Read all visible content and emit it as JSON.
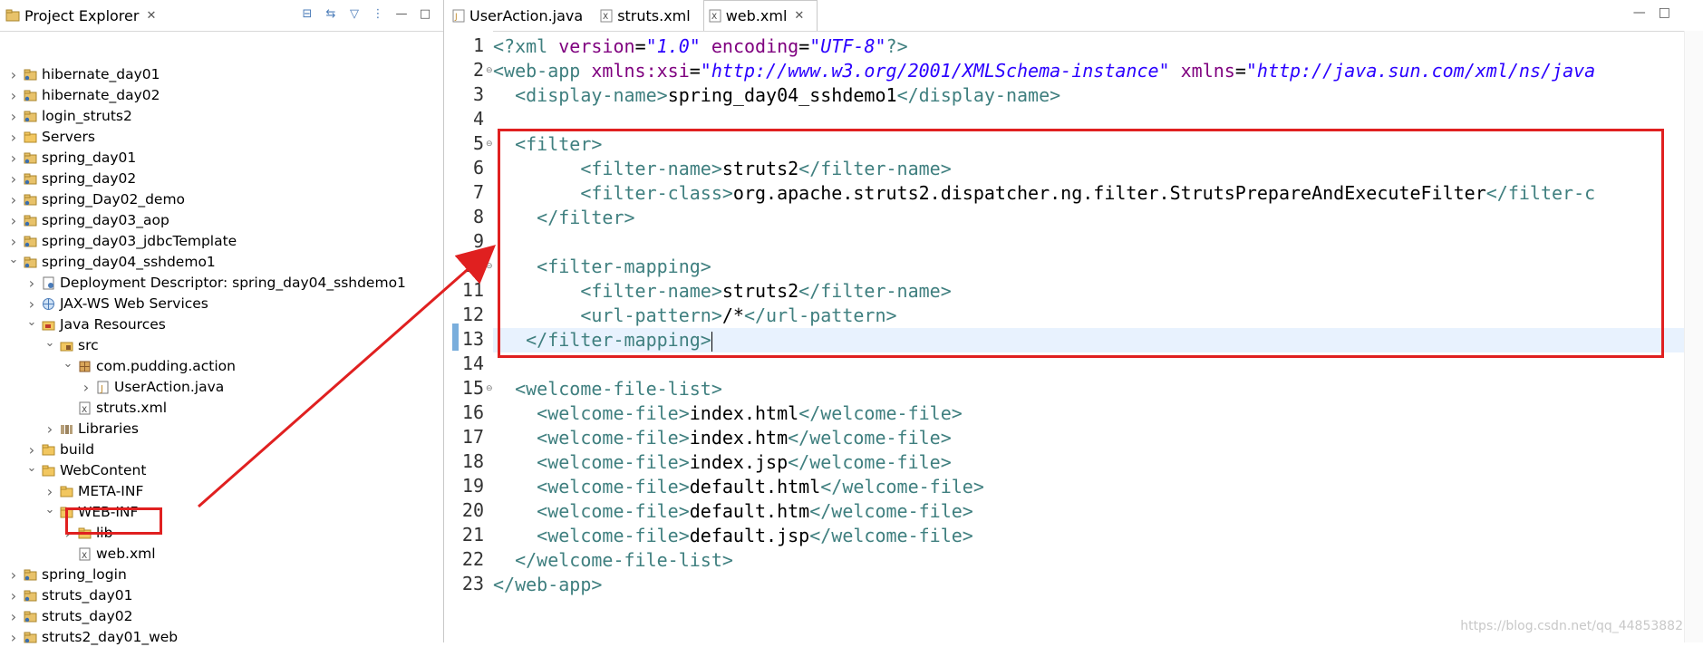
{
  "explorer": {
    "title": "Project Explorer",
    "items": [
      {
        "label": "hibernate_day01",
        "depth": 0,
        "expanded": false,
        "icon": "project-icon"
      },
      {
        "label": "hibernate_day02",
        "depth": 0,
        "expanded": false,
        "icon": "project-icon"
      },
      {
        "label": "login_struts2",
        "depth": 0,
        "expanded": false,
        "icon": "project-icon"
      },
      {
        "label": "Servers",
        "depth": 0,
        "expanded": false,
        "icon": "folder-icon"
      },
      {
        "label": "spring_day01",
        "depth": 0,
        "expanded": false,
        "icon": "project-icon"
      },
      {
        "label": "spring_day02",
        "depth": 0,
        "expanded": false,
        "icon": "project-icon"
      },
      {
        "label": "spring_Day02_demo",
        "depth": 0,
        "expanded": false,
        "icon": "project-icon"
      },
      {
        "label": "spring_day03_aop",
        "depth": 0,
        "expanded": false,
        "icon": "project-icon"
      },
      {
        "label": "spring_day03_jdbcTemplate",
        "depth": 0,
        "expanded": false,
        "icon": "project-icon"
      },
      {
        "label": "spring_day04_sshdemo1",
        "depth": 0,
        "expanded": true,
        "icon": "project-icon"
      },
      {
        "label": "Deployment Descriptor: spring_day04_sshdemo1",
        "depth": 1,
        "expanded": false,
        "icon": "descriptor-icon"
      },
      {
        "label": "JAX-WS Web Services",
        "depth": 1,
        "expanded": false,
        "icon": "webservice-icon"
      },
      {
        "label": "Java Resources",
        "depth": 1,
        "expanded": true,
        "icon": "java-resources-icon"
      },
      {
        "label": "src",
        "depth": 2,
        "expanded": true,
        "icon": "source-folder-icon"
      },
      {
        "label": "com.pudding.action",
        "depth": 3,
        "expanded": true,
        "icon": "package-icon"
      },
      {
        "label": "UserAction.java",
        "depth": 4,
        "expanded": false,
        "icon": "java-file-icon"
      },
      {
        "label": "struts.xml",
        "depth": 3,
        "expanded": null,
        "icon": "xml-file-icon"
      },
      {
        "label": "Libraries",
        "depth": 2,
        "expanded": false,
        "icon": "library-icon"
      },
      {
        "label": "build",
        "depth": 1,
        "expanded": false,
        "icon": "folder-icon"
      },
      {
        "label": "WebContent",
        "depth": 1,
        "expanded": true,
        "icon": "folder-icon"
      },
      {
        "label": "META-INF",
        "depth": 2,
        "expanded": false,
        "icon": "folder-icon"
      },
      {
        "label": "WEB-INF",
        "depth": 2,
        "expanded": true,
        "icon": "folder-icon"
      },
      {
        "label": "lib",
        "depth": 3,
        "expanded": false,
        "icon": "folder-icon"
      },
      {
        "label": "web.xml",
        "depth": 3,
        "expanded": null,
        "icon": "xml-file-icon"
      },
      {
        "label": "spring_login",
        "depth": 0,
        "expanded": false,
        "icon": "project-icon"
      },
      {
        "label": "struts_day01",
        "depth": 0,
        "expanded": false,
        "icon": "project-icon"
      },
      {
        "label": "struts_day02",
        "depth": 0,
        "expanded": false,
        "icon": "project-icon"
      },
      {
        "label": "struts2_day01_web",
        "depth": 0,
        "expanded": false,
        "icon": "project-icon"
      }
    ]
  },
  "editor": {
    "tabs": [
      {
        "label": "UserAction.java",
        "active": false,
        "icon": "java-file-icon"
      },
      {
        "label": "struts.xml",
        "active": false,
        "icon": "xml-file-icon"
      },
      {
        "label": "web.xml",
        "active": true,
        "icon": "xml-file-icon"
      }
    ],
    "current_line": 13,
    "lines": [
      "<?xml version=\"1.0\" encoding=\"UTF-8\"?>",
      "<web-app xmlns:xsi=\"http://www.w3.org/2001/XMLSchema-instance\" xmlns=\"http://java.sun.com/xml/ns/java",
      "  <display-name>spring_day04_sshdemo1</display-name>",
      "",
      "  <filter>",
      "        <filter-name>struts2</filter-name>",
      "        <filter-class>org.apache.struts2.dispatcher.ng.filter.StrutsPrepareAndExecuteFilter</filter-c",
      "    </filter>",
      "",
      "    <filter-mapping>",
      "        <filter-name>struts2</filter-name>",
      "        <url-pattern>/*</url-pattern>",
      "   </filter-mapping>",
      "",
      "  <welcome-file-list>",
      "    <welcome-file>index.html</welcome-file>",
      "    <welcome-file>index.htm</welcome-file>",
      "    <welcome-file>index.jsp</welcome-file>",
      "    <welcome-file>default.html</welcome-file>",
      "    <welcome-file>default.htm</welcome-file>",
      "    <welcome-file>default.jsp</welcome-file>",
      "  </welcome-file-list>",
      "</web-app>"
    ],
    "folded_lines": [
      2,
      5,
      10,
      15
    ]
  },
  "watermark": "https://blog.csdn.net/qq_44853882",
  "colors": {
    "tag": "#3f7f7f",
    "attribute": "#7f007f",
    "value": "#2a00ff",
    "highlight": "#e02020",
    "current_line": "#e8f2fe"
  }
}
